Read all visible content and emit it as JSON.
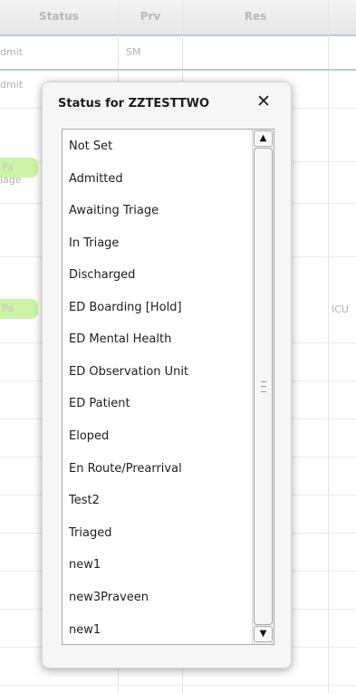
{
  "grid": {
    "headers": [
      "Status",
      "Prv",
      "Res"
    ],
    "row1": {
      "status": "dmit",
      "prv": "SM"
    },
    "row2": {
      "status": "dmit"
    },
    "row3": {
      "pill": "Pa"
    },
    "row4": {
      "status": "iage"
    },
    "row5": {
      "pill": "Pa",
      "res": "ICU"
    }
  },
  "popup": {
    "title": "Status for ZZTESTTWO",
    "close_symbol": "✕",
    "options": [
      "Not Set",
      "Admitted",
      "Awaiting Triage",
      "In Triage",
      "Discharged",
      "ED Boarding [Hold]",
      "ED Mental Health",
      "ED Observation Unit",
      "ED Patient",
      "Eloped",
      "En Route/Prearrival",
      "Test2",
      "Triaged",
      "new1",
      "new3Praveen",
      "new1"
    ],
    "scroll_up": "▲",
    "scroll_down": "▼"
  }
}
